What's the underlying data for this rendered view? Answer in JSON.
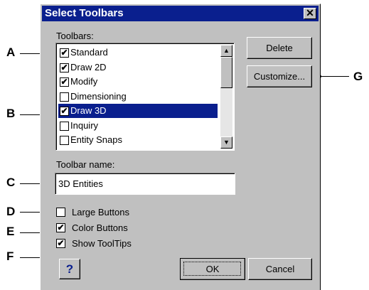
{
  "dialog": {
    "title": "Select Toolbars",
    "close_glyph": "✕",
    "toolbars_label": "Toolbars:",
    "toolbars": [
      {
        "label": "Standard",
        "checked": true,
        "selected": false
      },
      {
        "label": "Draw 2D",
        "checked": true,
        "selected": false
      },
      {
        "label": "Modify",
        "checked": true,
        "selected": false
      },
      {
        "label": "Dimensioning",
        "checked": false,
        "selected": false
      },
      {
        "label": "Draw 3D",
        "checked": true,
        "selected": true
      },
      {
        "label": "Inquiry",
        "checked": false,
        "selected": false
      },
      {
        "label": "Entity Snaps",
        "checked": false,
        "selected": false
      }
    ],
    "toolbar_name_label": "Toolbar name:",
    "toolbar_name_value": "3D Entities",
    "options": [
      {
        "label": "Large Buttons",
        "checked": false
      },
      {
        "label": "Color Buttons",
        "checked": true
      },
      {
        "label": "Show ToolTips",
        "checked": true
      }
    ],
    "buttons": {
      "delete": "Delete",
      "customize": "Customize...",
      "ok": "OK",
      "cancel": "Cancel",
      "help": "?"
    },
    "check_glyph": "✔",
    "scroll_up_glyph": "▲",
    "scroll_down_glyph": "▼",
    "accent_color": "#0a1f8e",
    "help_color": "#0a1f8e"
  },
  "callouts": [
    "A",
    "B",
    "C",
    "D",
    "E",
    "F",
    "G"
  ]
}
